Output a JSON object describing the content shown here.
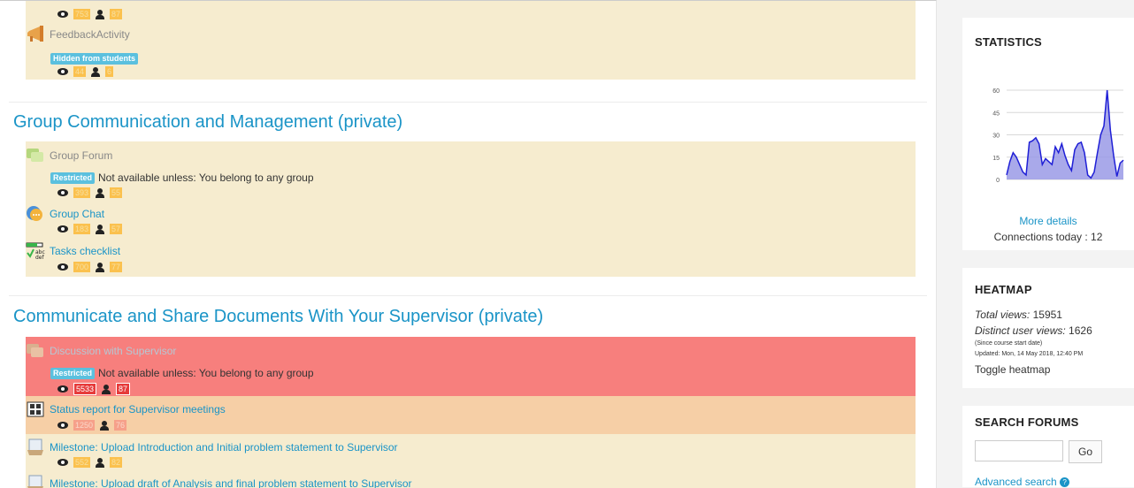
{
  "sections": {
    "top_items": [
      {
        "name": "",
        "stats": {
          "views": "753",
          "users": "87"
        }
      },
      {
        "name": "FeedbackActivity",
        "tag": "Hidden from students",
        "stats": {
          "views": "44",
          "users": "6"
        }
      }
    ],
    "group": {
      "title": "Group Communication and Management (private)",
      "items": [
        {
          "name": "Group Forum",
          "badge": "Restricted",
          "availability": "Not available unless: You belong to any group",
          "stats": {
            "views": "393",
            "users": "55"
          }
        },
        {
          "name": "Group Chat",
          "stats": {
            "views": "183",
            "users": "57"
          }
        },
        {
          "name": "Tasks checklist",
          "stats": {
            "views": "700",
            "users": "77"
          }
        }
      ]
    },
    "supervisor": {
      "title": "Communicate and Share Documents With Your Supervisor (private)",
      "items": [
        {
          "name": "Discussion with Supervisor",
          "badge": "Restricted",
          "availability": "Not available unless: You belong to any group",
          "stats": {
            "views": "5533",
            "users": "87"
          }
        },
        {
          "name": "Status report for Supervisor meetings",
          "stats": {
            "views": "1250",
            "users": "76"
          }
        },
        {
          "name": "Milestone: Upload Introduction and Initial problem statement to Supervisor",
          "stats": {
            "views": "552",
            "users": "82"
          }
        },
        {
          "name": "Milestone: Upload draft of Analysis and final problem statement to Supervisor"
        }
      ]
    }
  },
  "statistics": {
    "title": "STATISTICS",
    "more_details": "More details",
    "connections": "Connections today : 12",
    "chart_data": {
      "type": "area",
      "title": "",
      "xlabel": "",
      "ylabel": "",
      "ylim": [
        0,
        60
      ],
      "yticks": [
        "0",
        "15",
        "30",
        "45",
        "60"
      ],
      "grid": true,
      "color": "#1f1fd6",
      "fill": "#9a9ae6",
      "values": [
        3,
        12,
        18,
        15,
        10,
        5,
        3,
        25,
        26,
        28,
        24,
        10,
        14,
        12,
        10,
        22,
        18,
        24,
        16,
        10,
        6,
        20,
        24,
        25,
        18,
        3,
        1,
        5,
        18,
        30,
        36,
        60,
        33,
        16,
        2,
        11,
        13
      ]
    }
  },
  "heatmap": {
    "title": "HEATMAP",
    "total_label": "Total views:",
    "total_value": "15951",
    "distinct_label": "Distinct user views:",
    "distinct_value": "1626",
    "since": "(Since course start date)",
    "updated": "Updated: Mon, 14 May 2018, 12:40 PM",
    "toggle": "Toggle heatmap"
  },
  "search_forums": {
    "title": "SEARCH FORUMS",
    "placeholder": "",
    "go": "Go",
    "advanced": "Advanced search"
  }
}
